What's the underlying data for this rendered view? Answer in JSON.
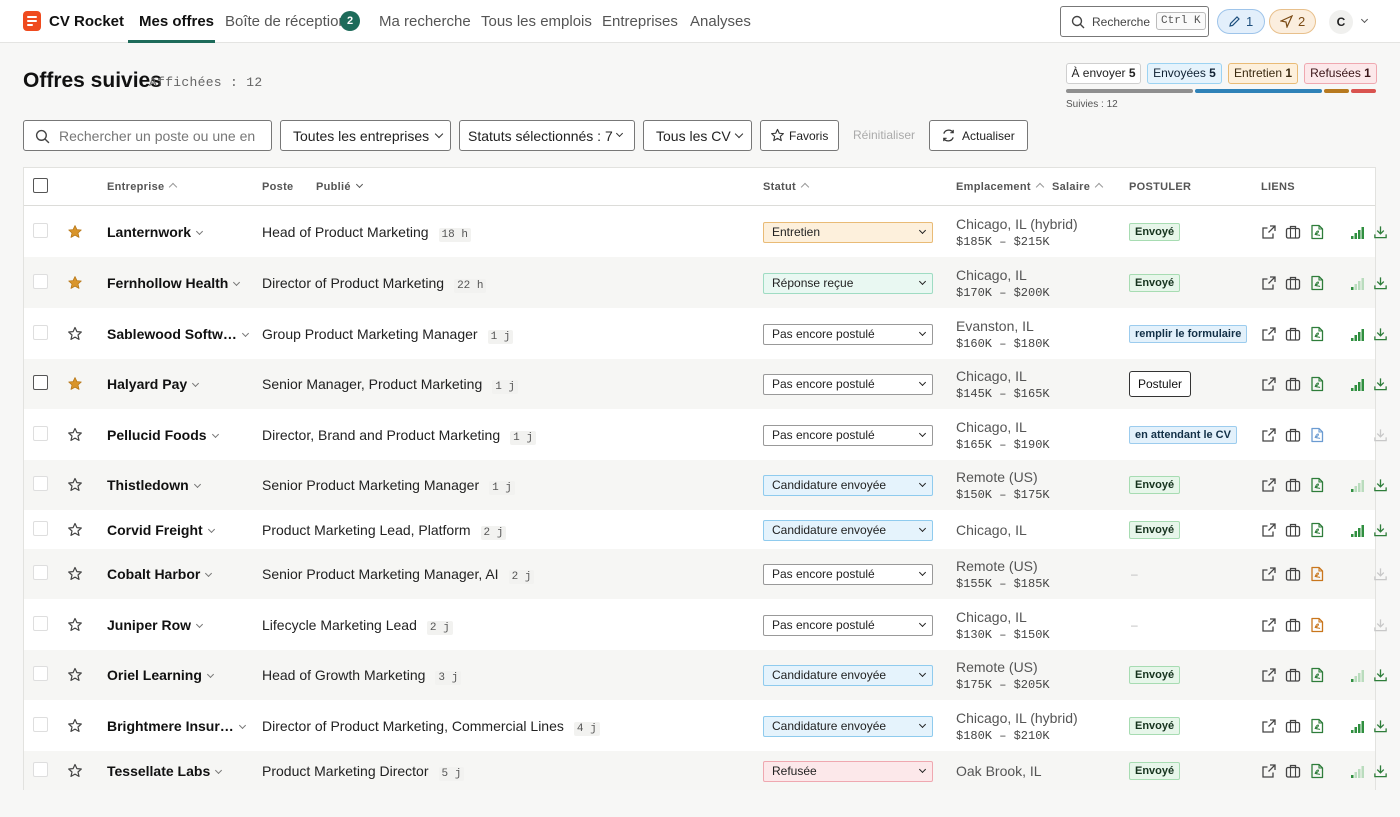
{
  "app": {
    "brand": "CV Rocket",
    "nav": [
      {
        "label": "Mes offres",
        "active": true
      },
      {
        "label": "Boîte de réception",
        "badge": "2"
      },
      {
        "label": "Ma recherche"
      },
      {
        "label": "Tous les emplois"
      },
      {
        "label": "Entreprises"
      },
      {
        "label": "Analyses"
      }
    ],
    "search_label": "Recherche",
    "search_shortcut": "Ctrl K",
    "edit_count": "1",
    "send_count": "2",
    "avatar": "C"
  },
  "header": {
    "title": "Offres suivies",
    "shown": "Affichées : 12",
    "tracked": "Suivies : 12",
    "status_counts": [
      {
        "label": "À envoyer",
        "count": "5"
      },
      {
        "label": "Envoyées",
        "count": "5"
      },
      {
        "label": "Entretien",
        "count": "1"
      },
      {
        "label": "Refusées",
        "count": "1"
      }
    ],
    "progress_colors": [
      "#8f8f8f",
      "#2f82b8",
      "#b7791f",
      "#d9534f"
    ]
  },
  "toolbar": {
    "search_placeholder": "Rechercher un poste ou une en",
    "company_filter": "Toutes les entreprises",
    "status_filter": "Statuts sélectionnés : 7",
    "cv_filter": "Tous les CV",
    "favorites": "Favoris",
    "reset": "Réinitialiser",
    "refresh": "Actualiser"
  },
  "table": {
    "columns": {
      "company": "Entreprise",
      "position": "Poste",
      "published": "Publié",
      "status": "Statut",
      "location": "Emplacement",
      "salary": "Salaire",
      "apply": "POSTULER",
      "links": "LIENS"
    },
    "rows": [
      {
        "company": "Lanternwork",
        "starred": true,
        "position": "Head of Product Marketing",
        "age": "18 h",
        "status": "Entretien",
        "status_type": "entretien",
        "location": "Chicago, IL (hybrid)",
        "salary": "$185K – $215K",
        "apply": "Envoyé",
        "apply_type": "sent",
        "cv": "green",
        "signal": "full",
        "download": true
      },
      {
        "company": "Fernhollow Health",
        "starred": true,
        "position": "Director of Product Marketing",
        "age": "22 h",
        "status": "Réponse reçue",
        "status_type": "reponse",
        "location": "Chicago, IL",
        "salary": "$170K – $200K",
        "apply": "Envoyé",
        "apply_type": "sent",
        "cv": "green",
        "signal": "low",
        "download": true
      },
      {
        "company": "Sablewood Softw…",
        "starred": false,
        "position": "Group Product Marketing Manager",
        "age": "1 j",
        "status": "Pas encore postulé",
        "status_type": "none",
        "location": "Evanston, IL",
        "salary": "$160K – $180K",
        "apply": "remplir le formulaire",
        "apply_type": "info",
        "cv": "green",
        "signal": "full",
        "download": true
      },
      {
        "company": "Halyard Pay",
        "starred": true,
        "position": "Senior Manager, Product Marketing",
        "age": "1 j",
        "status": "Pas encore postulé",
        "status_type": "none",
        "location": "Chicago, IL",
        "salary": "$145K – $165K",
        "apply": "Postuler",
        "apply_type": "button",
        "cv": "green",
        "signal": "full",
        "download": true,
        "strong_check": true
      },
      {
        "company": "Pellucid Foods",
        "starred": false,
        "position": "Director, Brand and Product Marketing",
        "age": "1 j",
        "status": "Pas encore postulé",
        "status_type": "none",
        "location": "Chicago, IL",
        "salary": "$165K – $190K",
        "apply": "en attendant le CV",
        "apply_type": "info",
        "cv": "blue",
        "signal": "none",
        "download": false
      },
      {
        "company": "Thistledown",
        "starred": false,
        "position": "Senior Product Marketing Manager",
        "age": "1 j",
        "status": "Candidature envoyée",
        "status_type": "envoyee",
        "location": "Remote (US)",
        "salary": "$150K – $175K",
        "apply": "Envoyé",
        "apply_type": "sent",
        "cv": "green",
        "signal": "low",
        "download": true
      },
      {
        "company": "Corvid Freight",
        "starred": false,
        "position": "Product Marketing Lead, Platform",
        "age": "2 j",
        "status": "Candidature envoyée",
        "status_type": "envoyee",
        "location": "Chicago, IL",
        "salary": "",
        "apply": "Envoyé",
        "apply_type": "sent",
        "cv": "green",
        "signal": "full",
        "download": true
      },
      {
        "company": "Cobalt Harbor",
        "starred": false,
        "position": "Senior Product Marketing Manager, AI",
        "age": "2 j",
        "status": "Pas encore postulé",
        "status_type": "none",
        "location": "Remote (US)",
        "salary": "$155K – $185K",
        "apply": "–",
        "apply_type": "none",
        "cv": "orange",
        "signal": "none",
        "download": false
      },
      {
        "company": "Juniper Row",
        "starred": false,
        "position": "Lifecycle Marketing Lead",
        "age": "2 j",
        "status": "Pas encore postulé",
        "status_type": "none",
        "location": "Chicago, IL",
        "salary": "$130K – $150K",
        "apply": "–",
        "apply_type": "none",
        "cv": "orange",
        "signal": "none",
        "download": false
      },
      {
        "company": "Oriel Learning",
        "starred": false,
        "position": "Head of Growth Marketing",
        "age": "3 j",
        "status": "Candidature envoyée",
        "status_type": "envoyee",
        "location": "Remote (US)",
        "salary": "$175K – $205K",
        "apply": "Envoyé",
        "apply_type": "sent",
        "cv": "green",
        "signal": "low",
        "download": true
      },
      {
        "company": "Brightmere Insur…",
        "starred": false,
        "position": "Director of Product Marketing, Commercial Lines",
        "age": "4 j",
        "status": "Candidature envoyée",
        "status_type": "envoyee",
        "location": "Chicago, IL (hybrid)",
        "salary": "$180K – $210K",
        "apply": "Envoyé",
        "apply_type": "sent",
        "cv": "green",
        "signal": "full",
        "download": true
      },
      {
        "company": "Tessellate Labs",
        "starred": false,
        "position": "Product Marketing Director",
        "age": "5 j",
        "status": "Refusée",
        "status_type": "refusee",
        "location": "Oak Brook, IL",
        "salary": "",
        "apply": "Envoyé",
        "apply_type": "sent",
        "cv": "green",
        "signal": "low",
        "download": true
      }
    ]
  }
}
